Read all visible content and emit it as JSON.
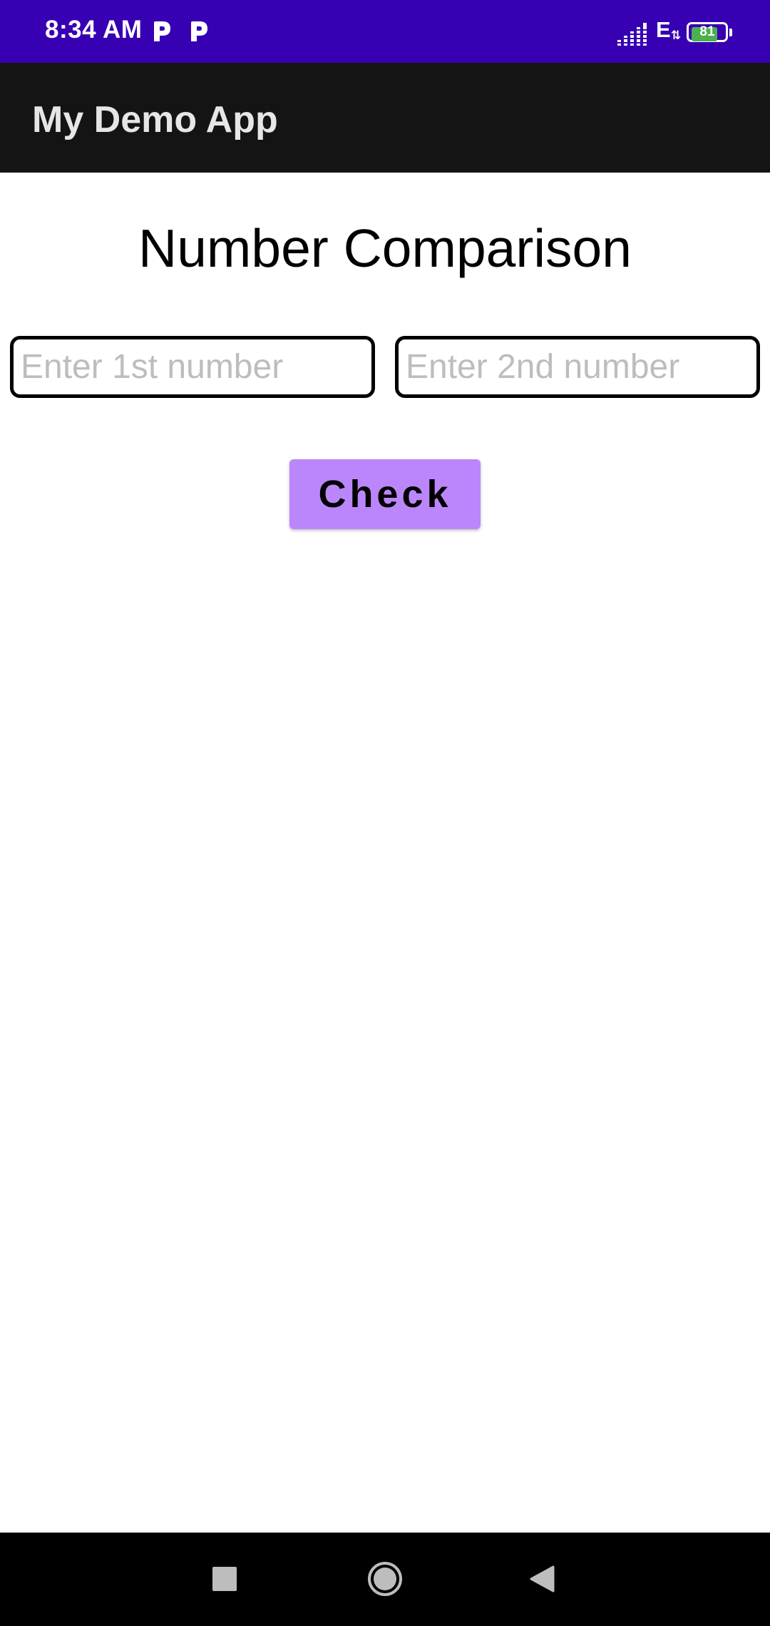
{
  "status_bar": {
    "time": "8:34 AM",
    "notification_icons": [
      "p-icon",
      "p-icon"
    ],
    "network_type": "E",
    "network_activity": "⇅",
    "battery_level": "81",
    "battery_fraction": 0.81,
    "background_color": "#3700b3"
  },
  "app_bar": {
    "title": "My Demo App",
    "background_color": "#141414"
  },
  "main": {
    "heading": "Number Comparison",
    "first_input": {
      "placeholder": "Enter 1st number",
      "value": ""
    },
    "second_input": {
      "placeholder": "Enter 2nd number",
      "value": ""
    },
    "check_button_label": "Check",
    "button_color": "#bb86fc"
  },
  "nav_bar": {
    "buttons": [
      "recents-square-icon",
      "home-circle-icon",
      "back-triangle-icon"
    ]
  }
}
